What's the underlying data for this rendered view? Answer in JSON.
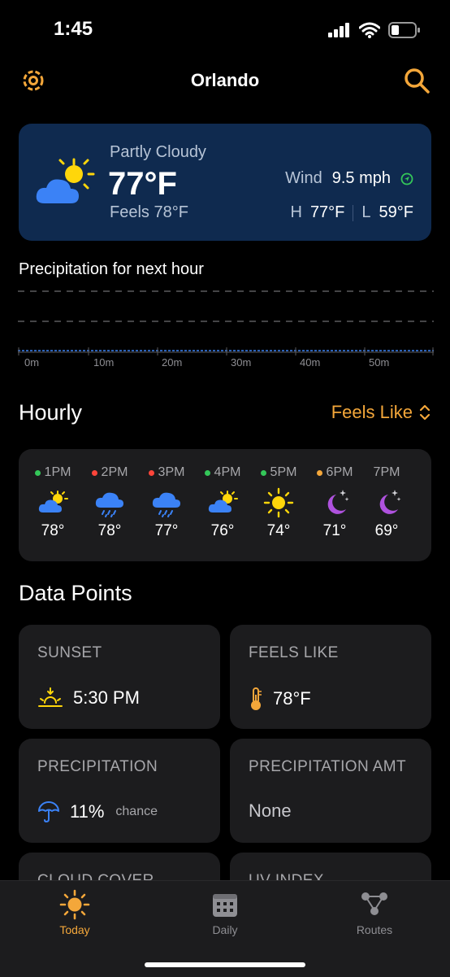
{
  "status_bar": {
    "time": "1:45"
  },
  "header": {
    "city": "Orlando"
  },
  "current": {
    "condition": "Partly Cloudy",
    "temperature": "77°F",
    "feels_like": "Feels 78°F",
    "wind_label": "Wind",
    "wind_value": "9.5 mph",
    "high_label": "H",
    "high_value": "77°F",
    "low_label": "L",
    "low_value": "59°F"
  },
  "precipitation_chart": {
    "title": "Precipitation for next hour",
    "tick_labels": [
      "0m",
      "10m",
      "20m",
      "30m",
      "40m",
      "50m"
    ]
  },
  "hourly": {
    "title": "Hourly",
    "mode_label": "Feels Like",
    "items": [
      {
        "time": "1PM",
        "temp": "78°",
        "icon": "partly-cloudy-icon",
        "dot_color": "#34c759"
      },
      {
        "time": "2PM",
        "temp": "78°",
        "icon": "rain-icon",
        "dot_color": "#ff453a"
      },
      {
        "time": "3PM",
        "temp": "77°",
        "icon": "rain-icon",
        "dot_color": "#ff453a"
      },
      {
        "time": "4PM",
        "temp": "76°",
        "icon": "partly-cloudy-icon",
        "dot_color": "#34c759"
      },
      {
        "time": "5PM",
        "temp": "74°",
        "icon": "sun-icon",
        "dot_color": "#34c759"
      },
      {
        "time": "6PM",
        "temp": "71°",
        "icon": "moon-icon",
        "dot_color": "#f4a73a"
      },
      {
        "time": "7PM",
        "temp": "69°",
        "icon": "moon-icon",
        "dot_color": ""
      }
    ]
  },
  "data_points": {
    "title": "Data Points",
    "cards": [
      {
        "label": "SUNSET",
        "value": "5:30 PM",
        "icon": "sunset-icon"
      },
      {
        "label": "FEELS LIKE",
        "value": "78°F",
        "icon": "thermometer-icon"
      },
      {
        "label": "PRECIPITATION",
        "value": "11%",
        "suffix": "chance",
        "icon": "umbrella-icon"
      },
      {
        "label": "PRECIPITATION AMT",
        "value": "None"
      },
      {
        "label": "CLOUD COVER"
      },
      {
        "label": "UV INDEX"
      }
    ]
  },
  "tabbar": {
    "tabs": [
      {
        "label": "Today",
        "icon": "sun-icon",
        "active": true
      },
      {
        "label": "Daily",
        "icon": "calendar-icon"
      },
      {
        "label": "Routes",
        "icon": "routes-icon"
      }
    ]
  },
  "colors": {
    "accent": "#f4a73a",
    "card_blue": "#0f2a4f",
    "card_dark": "#1c1c1e",
    "wind_indicator": "#34c759"
  }
}
